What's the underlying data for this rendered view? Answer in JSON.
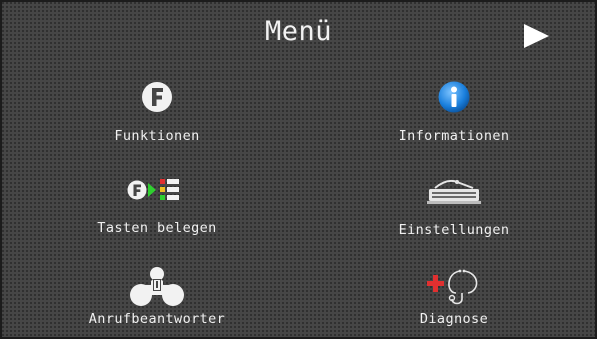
{
  "header": {
    "title": "Menü",
    "next_icon": "play-arrow-icon"
  },
  "menu": {
    "items": [
      {
        "label": "Funktionen",
        "icon": "function-f-icon"
      },
      {
        "label": "Informationen",
        "icon": "info-icon"
      },
      {
        "label": "Tasten belegen",
        "icon": "key-assign-icon"
      },
      {
        "label": "Einstellungen",
        "icon": "settings-keyboard-icon"
      },
      {
        "label": "Anrufbeantworter",
        "icon": "answering-machine-icon"
      },
      {
        "label": "Diagnose",
        "icon": "diagnose-stethoscope-icon"
      }
    ]
  },
  "colors": {
    "background": "#464646",
    "text": "#f0f0f0",
    "accent_green": "#2fd02f",
    "accent_red": "#e03030",
    "info_blue": "#1a7fdc"
  }
}
